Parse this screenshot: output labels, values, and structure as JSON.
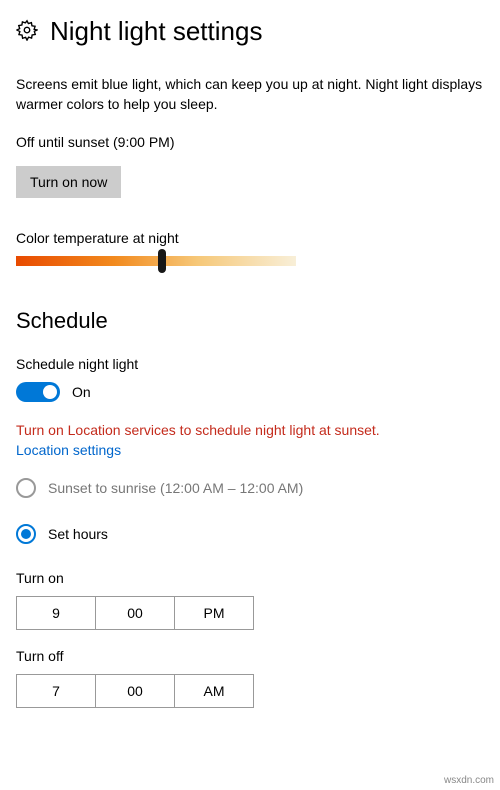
{
  "header": {
    "icon": "gear-icon",
    "title": "Night light settings"
  },
  "description": "Screens emit blue light, which can keep you up at night. Night light displays warmer colors to help you sleep.",
  "status": "Off until sunset (9:00 PM)",
  "turn_on_button": "Turn on now",
  "color_temp": {
    "label": "Color temperature at night",
    "value_percent": 52
  },
  "schedule": {
    "title": "Schedule",
    "toggle_label": "Schedule night light",
    "toggle_state": "On",
    "warning": "Turn on Location services to schedule night light at sunset.",
    "link": "Location settings",
    "options": {
      "sunset": "Sunset to sunrise (12:00 AM – 12:00 AM)",
      "set_hours": "Set hours"
    },
    "turn_on": {
      "label": "Turn on",
      "hour": "9",
      "minute": "00",
      "ampm": "PM"
    },
    "turn_off": {
      "label": "Turn off",
      "hour": "7",
      "minute": "00",
      "ampm": "AM"
    }
  },
  "watermark": "wsxdn.com"
}
